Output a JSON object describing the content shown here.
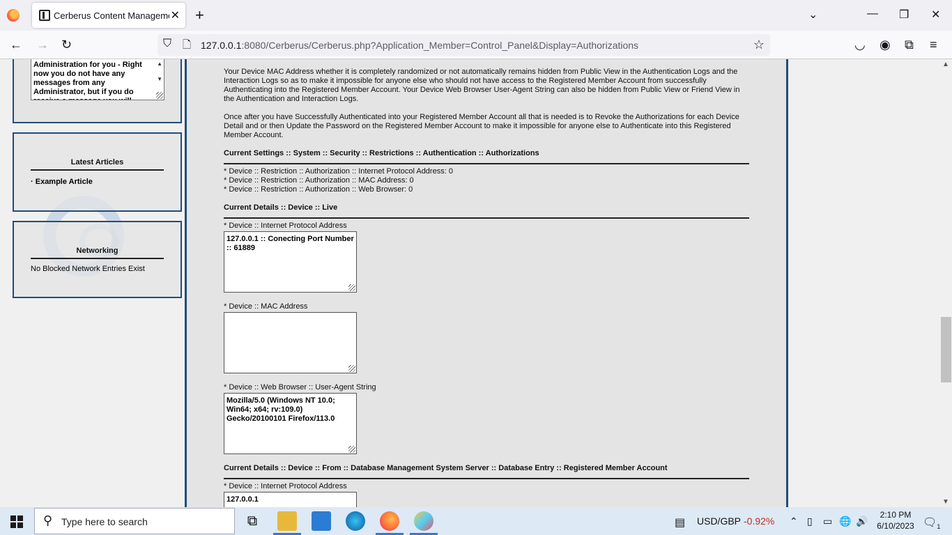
{
  "browser": {
    "tab_title": "Cerberus Content Management",
    "tab_close": "✕",
    "new_tab": "+",
    "url_host": "127.0.0.1",
    "url_rest": ":8080/Cerberus/Cerberus.php?Application_Member=Control_Panel&Display=Authorizations"
  },
  "sidebar": {
    "messages_text": "Administration for you - Right now you do not have any messages from any Administrator, but if you do receive a message you will",
    "latest_articles_title": "Latest Articles",
    "articles": [
      "Example Article"
    ],
    "networking_title": "Networking",
    "networking_text": "No Blocked Network Entries Exist"
  },
  "content": {
    "para1": "Your Device MAC Address whether it is completely randomized or not automatically remains hidden from Public View in the Authentication Logs and the Interaction Logs so as to make it impossible for anyone else who should not have access to the Registered Member Account from successfully Authenticating into the Registered Member Account. Your Device Web Browser User-Agent String can also be hidden from Public View or Friend View in the Authentication and Interaction Logs.",
    "para2": "Once after you have Successfully Authenticated into your Registered Member Account all that is needed is to Revoke the Authorizations for each Device Detail and or then Update the Password on the Registered Member Account to make it impossible for anyone else to Authenticate into this Registered Member Account.",
    "settings_heading": "Current Settings :: System :: Security :: Restrictions :: Authentication :: Authorizations",
    "settings": [
      "* Device :: Restriction :: Authorization :: Internet Protocol Address: 0",
      "* Device :: Restriction :: Authorization :: MAC Address: 0",
      "* Device :: Restriction :: Authorization :: Web Browser: 0"
    ],
    "live_heading": "Current Details :: Device :: Live",
    "ip_label": "* Device :: Internet Protocol Address",
    "ip_value": "127.0.0.1 :: Conecting Port Number :: 61889",
    "mac_label": "* Device :: MAC Address",
    "mac_value": "",
    "ua_label": "* Device :: Web Browser :: User-Agent String",
    "ua_value": "Mozilla/5.0 (Windows NT 10.0; Win64; x64; rv:109.0) Gecko/20100101 Firefox/113.0",
    "db_heading": "Current Details :: Device :: From :: Database Management System Server :: Database Entry :: Registered Member Account",
    "db_ip_label": "* Device :: Internet Protocol Address",
    "db_ip_value": "127.0.0.1"
  },
  "taskbar": {
    "search_placeholder": "Type here to search",
    "ticker_label": "USD/GBP",
    "ticker_change": "-0.92%",
    "ticker_color": "#c42b1c",
    "time": "2:10 PM",
    "date": "6/10/2023",
    "notification_count": "1"
  }
}
